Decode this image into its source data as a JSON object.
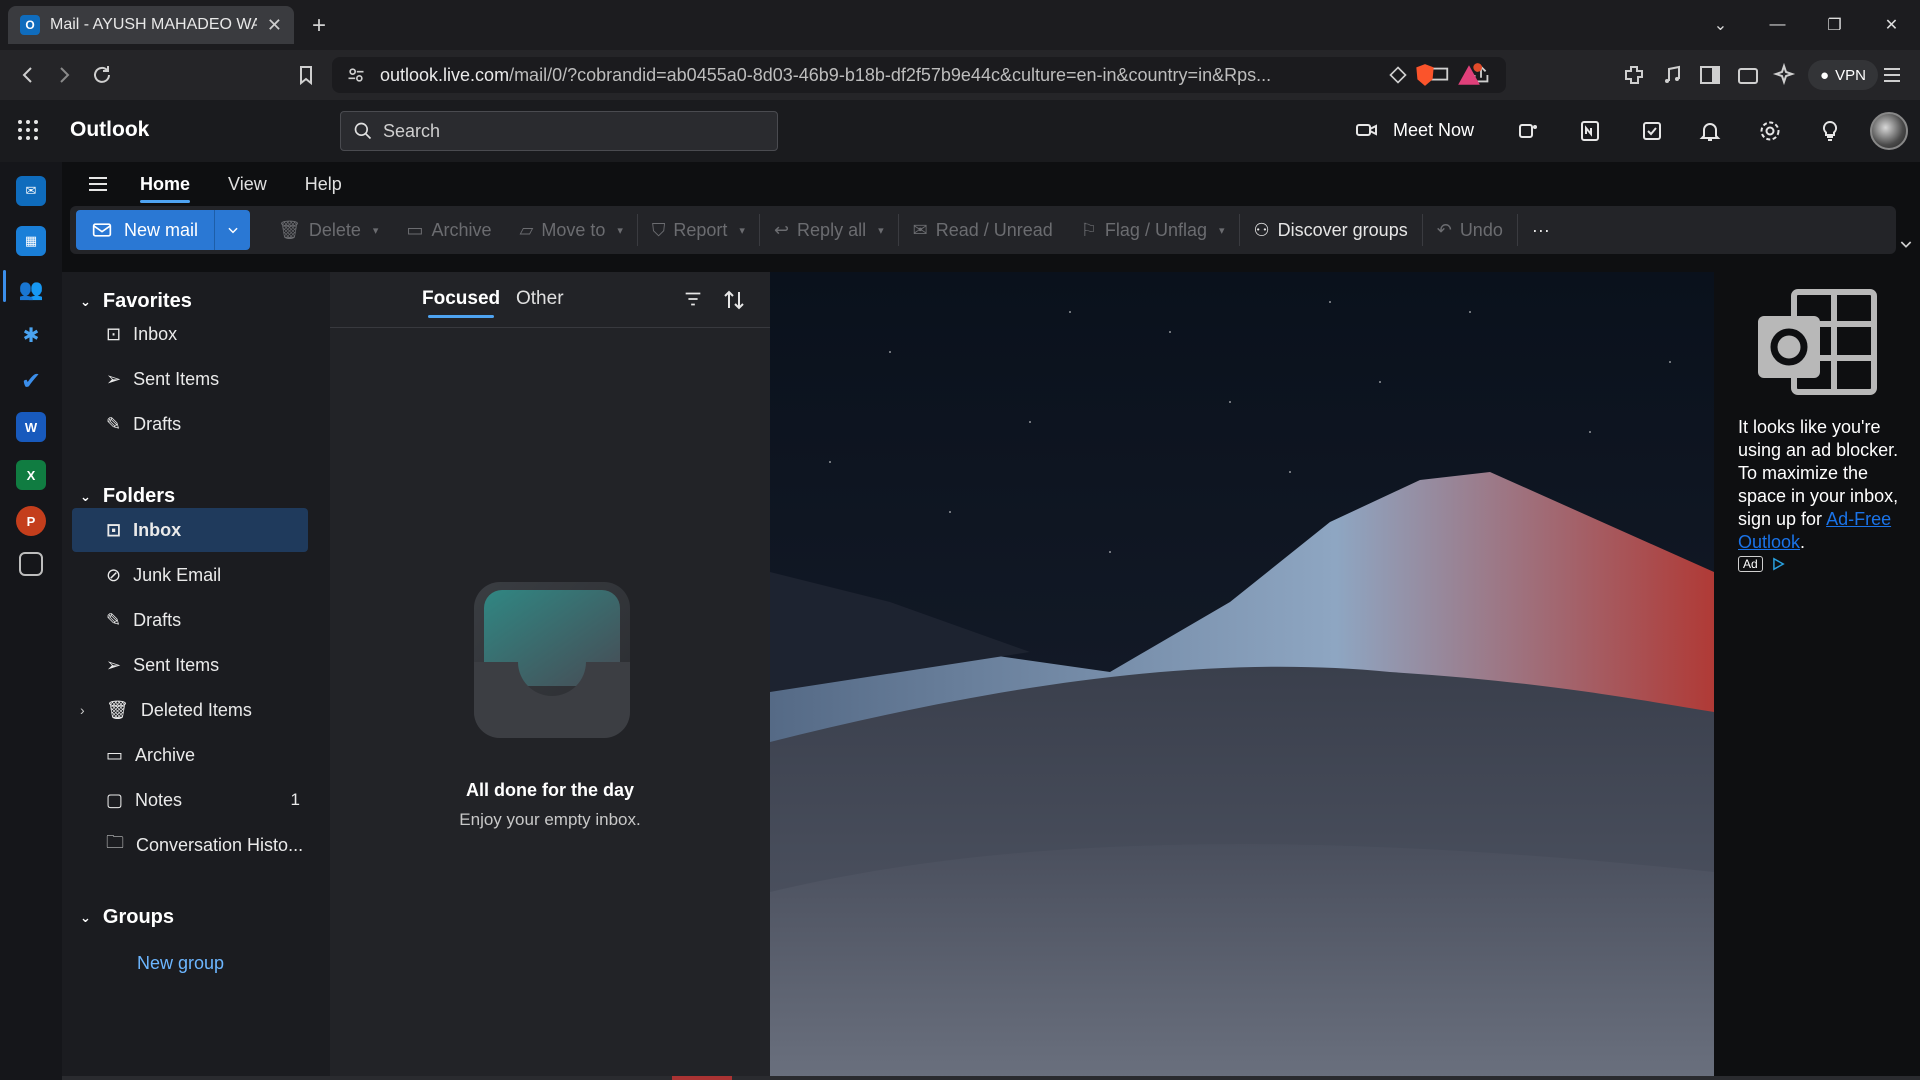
{
  "browser": {
    "tab_title": "Mail - AYUSH MAHADEO WASE",
    "tab_favicon": "O",
    "url_host": "outlook.live.com",
    "url_path": "/mail/0/?cobrandid=ab0455a0-8d03-46b9-b18b-df2f57b9e44c&culture=en-in&country=in&Rps...",
    "vpn_label": "VPN"
  },
  "header": {
    "brand": "Outlook",
    "search_placeholder": "Search",
    "meet_now": "Meet Now"
  },
  "ribbon": {
    "tabs": [
      "Home",
      "View",
      "Help"
    ],
    "new_mail": "New mail",
    "delete": "Delete",
    "archive": "Archive",
    "move_to": "Move to",
    "report": "Report",
    "reply_all": "Reply all",
    "read_unread": "Read / Unread",
    "flag_unflag": "Flag / Unflag",
    "discover_groups": "Discover groups",
    "undo": "Undo",
    "more": "···"
  },
  "folders": {
    "favorites_title": "Favorites",
    "favorites": [
      "Inbox",
      "Sent Items",
      "Drafts"
    ],
    "folders_title": "Folders",
    "items": [
      {
        "label": "Inbox",
        "count": ""
      },
      {
        "label": "Junk Email",
        "count": ""
      },
      {
        "label": "Drafts",
        "count": ""
      },
      {
        "label": "Sent Items",
        "count": ""
      },
      {
        "label": "Deleted Items",
        "count": ""
      },
      {
        "label": "Archive",
        "count": ""
      },
      {
        "label": "Notes",
        "count": "1"
      },
      {
        "label": "Conversation Histo...",
        "count": ""
      }
    ],
    "groups_title": "Groups",
    "new_group": "New group"
  },
  "message_list": {
    "tab_focused": "Focused",
    "tab_other": "Other",
    "empty_title": "All done for the day",
    "empty_subtitle": "Enjoy your empty inbox."
  },
  "ad": {
    "text_before": "It looks like you're using an ad blocker. To maximize the space in your inbox, sign up for ",
    "link_text": "Ad-Free Outlook",
    "text_after": ".",
    "badge": "Ad"
  },
  "colors": {
    "accent": "#2a78d4",
    "selected_folder": "#1f3a5c"
  }
}
